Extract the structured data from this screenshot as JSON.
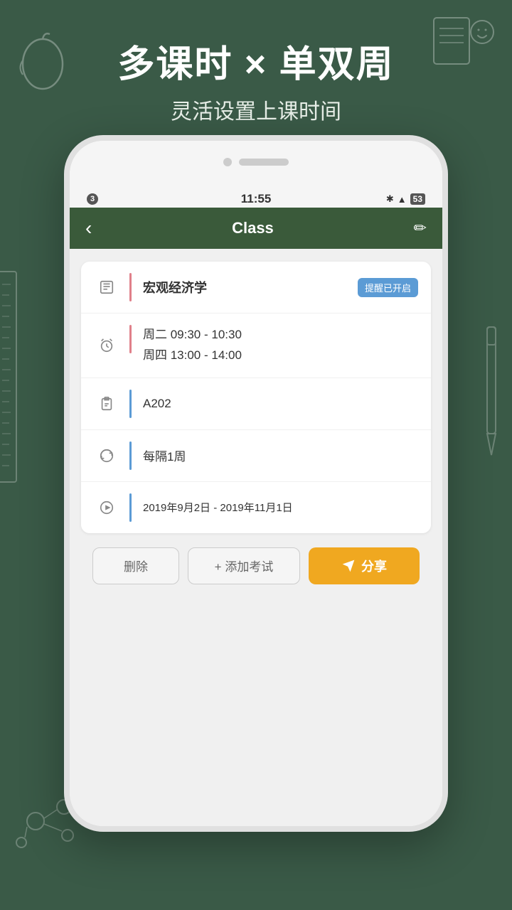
{
  "background": {
    "color": "#3a5a47"
  },
  "top_section": {
    "main_title": "多课时 × 单双周",
    "sub_title": "灵活设置上课时间"
  },
  "phone": {
    "status_bar": {
      "left": "3",
      "time": "11:55",
      "battery": "53"
    },
    "header": {
      "back_label": "‹",
      "title": "Class",
      "edit_icon": "✏"
    },
    "card": {
      "rows": [
        {
          "icon": "book",
          "divider_color": "red",
          "content": "宏观经济学",
          "badge": "提醒已开启"
        },
        {
          "icon": "alarm",
          "divider_color": "red",
          "line1": "周二 09:30 - 10:30",
          "line2": "周四 13:00 - 14:00"
        },
        {
          "icon": "clipboard",
          "divider_color": "blue",
          "content": "A202"
        },
        {
          "icon": "repeat",
          "divider_color": "blue",
          "content": "每隔1周"
        },
        {
          "icon": "play",
          "divider_color": "blue",
          "content": "2019年9月2日 - 2019年11月1日"
        }
      ]
    },
    "buttons": {
      "delete": "删除",
      "add_exam": "+ 添加考试",
      "share": "分享"
    }
  }
}
